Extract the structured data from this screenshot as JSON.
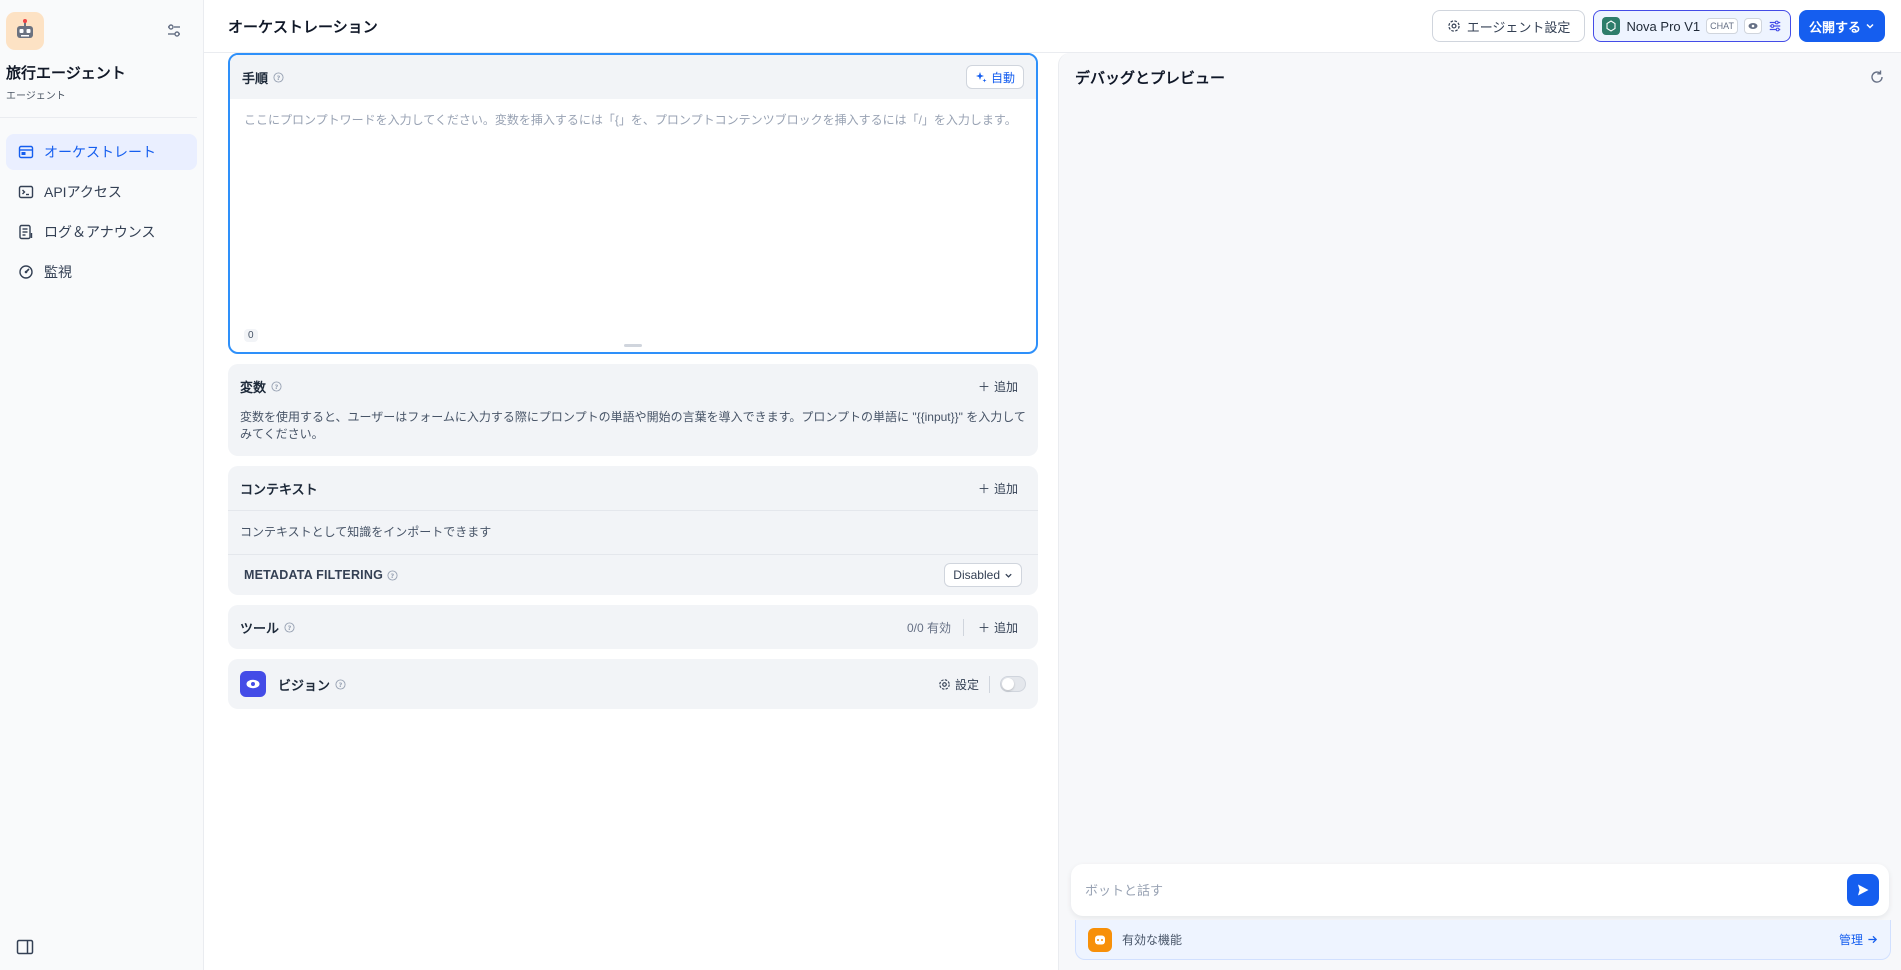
{
  "app": {
    "name": "旅行エージェント",
    "type": "エージェント"
  },
  "nav": [
    {
      "label": "オーケストレート",
      "icon": "layout-icon",
      "active": true
    },
    {
      "label": "APIアクセス",
      "icon": "terminal-icon",
      "active": false
    },
    {
      "label": "ログ＆アナウンス",
      "icon": "log-icon",
      "active": false
    },
    {
      "label": "監視",
      "icon": "gauge-icon",
      "active": false
    }
  ],
  "header": {
    "title": "オーケストレーション",
    "agent_settings": "エージェント設定",
    "model_name": "Nova Pro V1",
    "model_tag": "CHAT",
    "publish": "公開する"
  },
  "prompt": {
    "title": "手順",
    "auto_label": "自動",
    "placeholder": "ここにプロンプトワードを入力してください。変数を挿入するには「{」を、プロンプトコンテンツブロックを挿入するには「/」を入力します。",
    "char_count": "0"
  },
  "variables": {
    "title": "変数",
    "add_label": "追加",
    "description": "変数を使用すると、ユーザーはフォームに入力する際にプロンプトの単語や開始の言葉を導入できます。プロンプトの単語に \"{{input}}\" を入力してみてください。"
  },
  "context": {
    "title": "コンテキスト",
    "add_label": "追加",
    "description": "コンテキストとして知識をインポートできます",
    "metadata_label": "METADATA FILTERING",
    "metadata_value": "Disabled"
  },
  "tools": {
    "title": "ツール",
    "count": "0/0 有効",
    "add_label": "追加"
  },
  "vision": {
    "title": "ビジョン",
    "settings_label": "設定"
  },
  "debug": {
    "title": "デバッグとプレビュー",
    "input_placeholder": "ボットと話す",
    "features_label": "有効な機能",
    "manage_label": "管理"
  },
  "colors": {
    "accent": "#155eef",
    "active_nav_bg": "#eaefff",
    "prompt_border": "#2e90fa"
  }
}
